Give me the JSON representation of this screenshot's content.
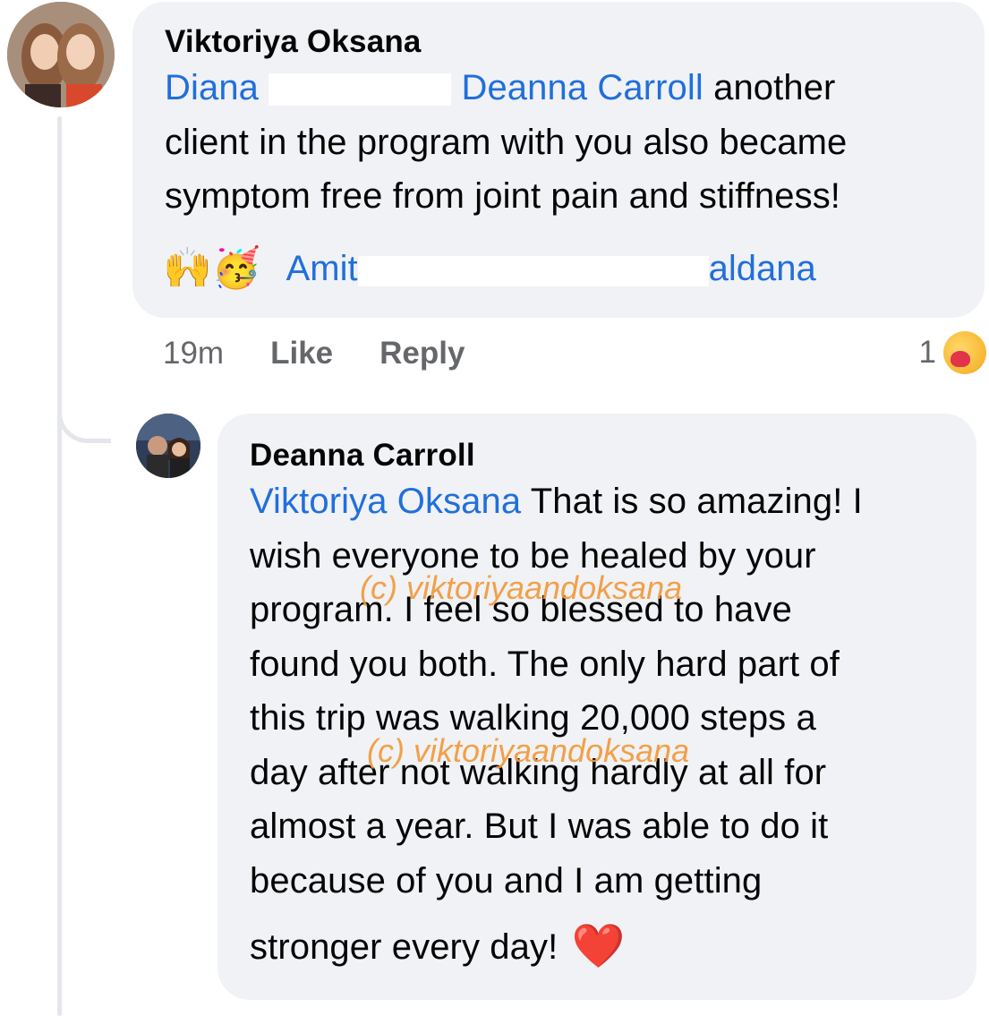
{
  "comment": {
    "author": "Viktoriya Oksana",
    "mentions": {
      "first": "Diana",
      "second": "Deanna Carroll",
      "reaction_tag_start": "Amit",
      "reaction_tag_end": "aldana"
    },
    "text_after_mention": "another",
    "text_line_2": "client in the program with you also became",
    "text_line_3": "symptom free from joint pain and stiffness!",
    "emoji_1": "raising-hands",
    "emoji_2": "partying-face",
    "time": "19m",
    "like_label": "Like",
    "reply_label": "Reply",
    "reaction_count": "1",
    "reaction_icon": "hugging-face-icon"
  },
  "reply": {
    "author": "Deanna Carroll",
    "mention": "Viktoriya Oksana",
    "line_1": "That is so amazing! I",
    "line_2": "wish everyone to be healed by your",
    "line_3": "program. I feel so blessed to have",
    "line_4": "found you both. The only hard part of",
    "line_5": "this trip was walking 20,000 steps a",
    "line_6": "day after not walking hardly at all for",
    "line_7": "almost a year. But I was able to do it",
    "line_8": "because of you and I am getting",
    "line_9": "stronger every day!",
    "heart": "❤️"
  },
  "watermark": "(c) viktoriyaandoksana",
  "colors": {
    "mention": "#216fdb",
    "bubble": "#f0f2f5",
    "meta": "#65676b",
    "watermark": "#f39a3b"
  }
}
